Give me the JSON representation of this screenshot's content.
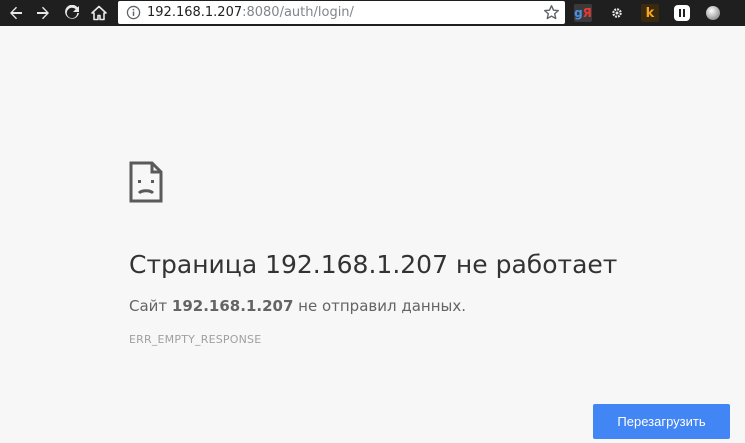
{
  "browser": {
    "url_host": "192.168.1.207",
    "url_rest": ":8080/auth/login/",
    "icons": {
      "back": "back-arrow-icon",
      "forward": "forward-arrow-icon",
      "reload": "reload-icon",
      "home": "home-icon",
      "info": "info-icon",
      "bookmark": "star-icon"
    },
    "extensions": {
      "yandex_g": "g",
      "yandex_ya": "Я",
      "k_label": "k"
    }
  },
  "error_page": {
    "title": "Страница 192.168.1.207 не работает",
    "message_prefix": "Сайт ",
    "message_host": "192.168.1.207",
    "message_suffix": " не отправил данных.",
    "error_code": "ERR_EMPTY_RESPONSE",
    "reload_label": "Перезагрузить"
  },
  "colors": {
    "toolbar_bg": "#1f1f1f",
    "page_bg": "#f7f7f7",
    "button_blue": "#4285f4"
  }
}
